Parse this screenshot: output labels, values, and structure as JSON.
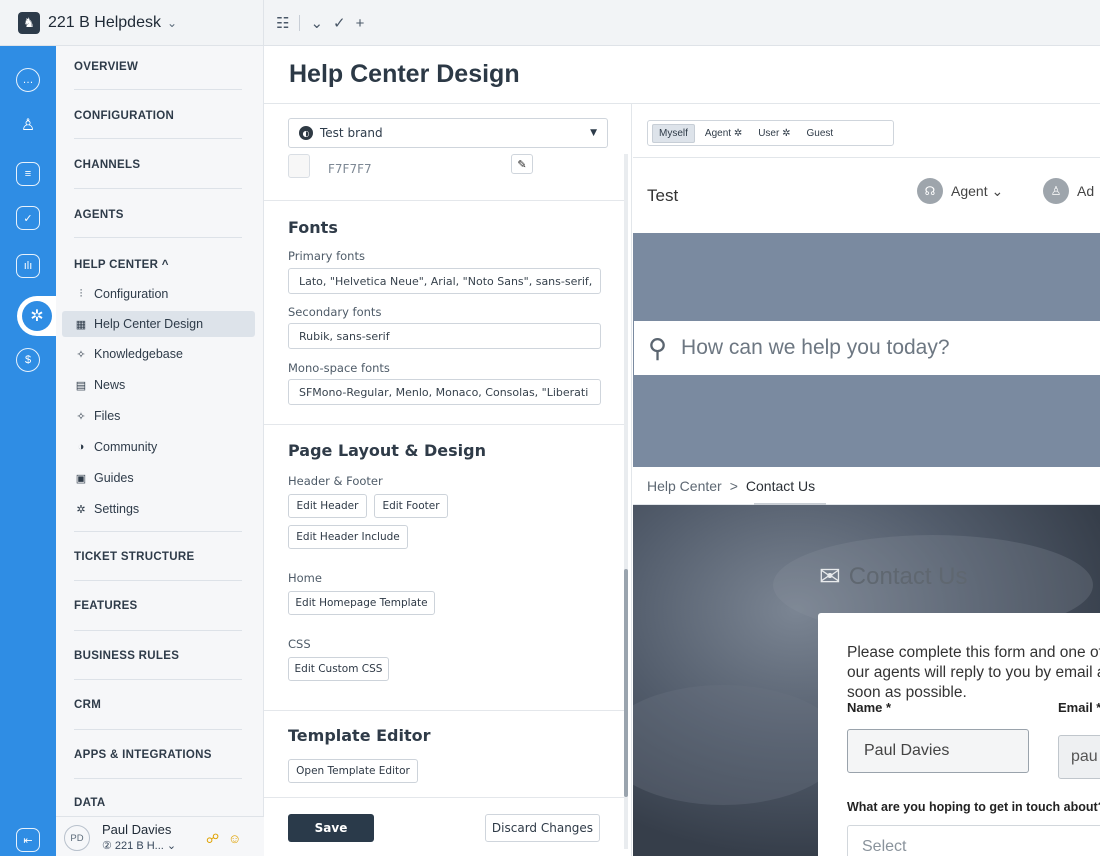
{
  "app": {
    "name": "221 B Helpdesk",
    "chevron": "⌄"
  },
  "topnav": {
    "list_icon": "☷",
    "down_icon": "⌄",
    "check_icon": "✓",
    "plus_icon": "+"
  },
  "sidebar": {
    "sections": [
      "OVERVIEW",
      "CONFIGURATION",
      "CHANNELS",
      "AGENTS",
      "HELP CENTER ^",
      "TICKET STRUCTURE",
      "FEATURES",
      "BUSINESS RULES",
      "CRM",
      "APPS & INTEGRATIONS",
      "DATA"
    ],
    "help_center_items": [
      {
        "icon": "⫶",
        "label": "Configuration"
      },
      {
        "icon": "▦",
        "label": "Help Center Design"
      },
      {
        "icon": "✧",
        "label": "Knowledgebase"
      },
      {
        "icon": "▤",
        "label": "News"
      },
      {
        "icon": "✧",
        "label": "Files"
      },
      {
        "icon": "◑",
        "label": "Community"
      },
      {
        "icon": "▣",
        "label": "Guides"
      },
      {
        "icon": "✲",
        "label": "Settings"
      }
    ],
    "user": {
      "initials": "PD",
      "name": "Paul Davies",
      "org": "② 221 B H...  ⌄"
    }
  },
  "page": {
    "title": "Help Center Design"
  },
  "settings": {
    "brand_select": "Test brand",
    "color_value": "F7F7F7",
    "fonts_heading": "Fonts",
    "primary_label": "Primary fonts",
    "primary_value": "Lato, \"Helvetica Neue\", Arial, \"Noto Sans\", sans-serif,",
    "secondary_label": "Secondary fonts",
    "secondary_value": "Rubik, sans-serif",
    "mono_label": "Mono-space fonts",
    "mono_value": "SFMono-Regular, Menlo, Monaco, Consolas, \"Liberati",
    "layout_heading": "Page Layout & Design",
    "hf_label": "Header & Footer",
    "edit_header": "Edit Header",
    "edit_footer": "Edit Footer",
    "edit_header_include": "Edit Header Include",
    "home_label": "Home",
    "edit_homepage": "Edit Homepage Template",
    "css_label": "CSS",
    "edit_css": "Edit Custom CSS",
    "template_heading": "Template Editor",
    "open_template": "Open Template Editor",
    "save": "Save",
    "discard": "Discard Changes"
  },
  "preview": {
    "views": [
      "Myself",
      "Agent ✲",
      "User ✲",
      "Guest"
    ],
    "site_title": "Test",
    "agent_label": "Agent ⌄",
    "user_label": "Ad",
    "search_placeholder": "How can we help you today?",
    "crumb_root": "Help Center",
    "crumb_sep": ">",
    "crumb_current": "Contact Us",
    "contact_title": "Contact Us",
    "intro": "Please complete this form and one of our agents will reply to you by email as soon as possible.",
    "name_label": "Name *",
    "name_value": "Paul Davies",
    "email_label": "Email *",
    "email_value": "pau",
    "question_label": "What are you hoping to get in touch about?",
    "select_placeholder": "Select"
  }
}
